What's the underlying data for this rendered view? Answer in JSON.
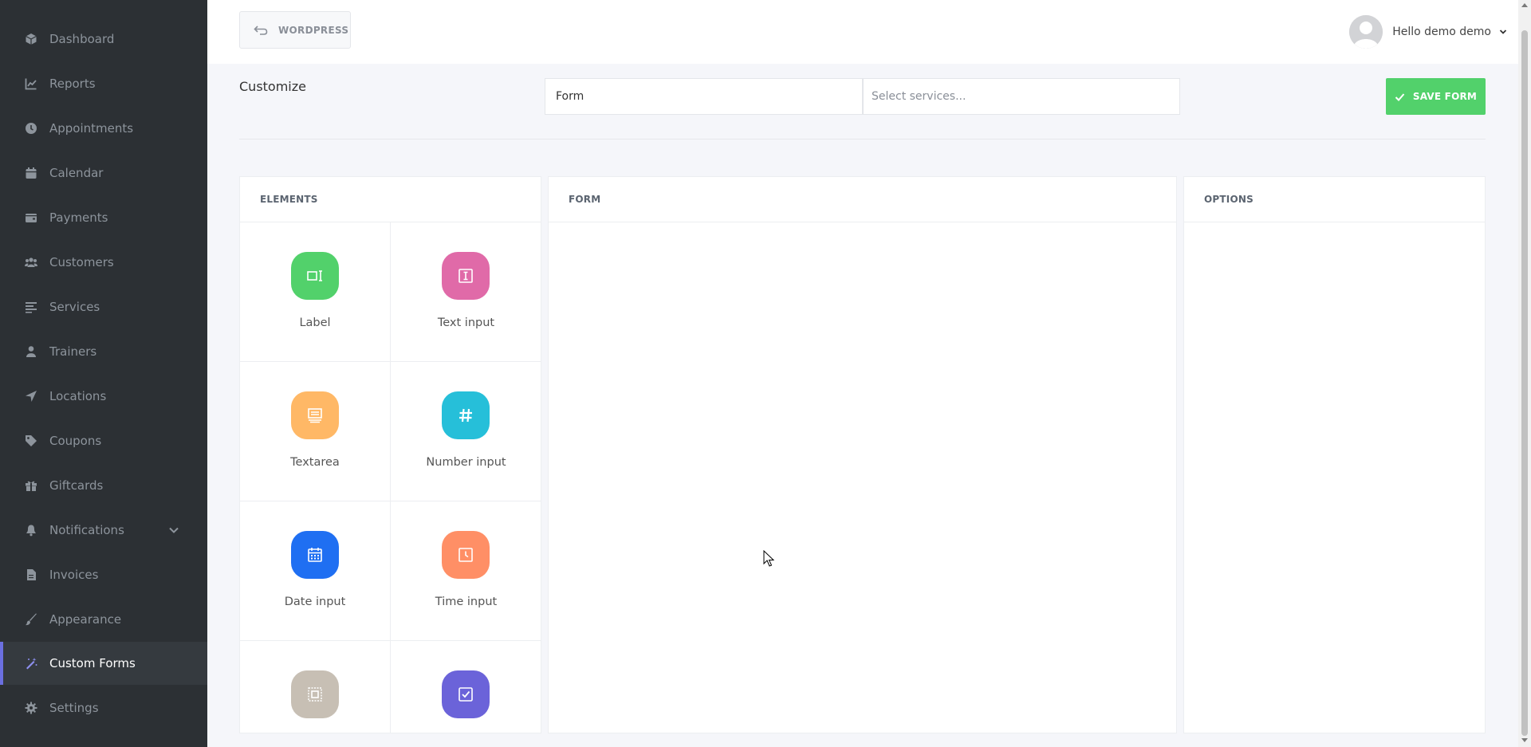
{
  "sidebar": {
    "items": [
      {
        "label": "Dashboard",
        "icon": "cube-icon"
      },
      {
        "label": "Reports",
        "icon": "chart-line-icon"
      },
      {
        "label": "Appointments",
        "icon": "clock-icon"
      },
      {
        "label": "Calendar",
        "icon": "calendar-icon"
      },
      {
        "label": "Payments",
        "icon": "wallet-icon"
      },
      {
        "label": "Customers",
        "icon": "users-icon"
      },
      {
        "label": "Services",
        "icon": "list-icon"
      },
      {
        "label": "Trainers",
        "icon": "user-icon"
      },
      {
        "label": "Locations",
        "icon": "location-arrow-icon"
      },
      {
        "label": "Coupons",
        "icon": "tag-icon"
      },
      {
        "label": "Giftcards",
        "icon": "gift-icon"
      },
      {
        "label": "Notifications",
        "icon": "bell-icon",
        "has_submenu": true
      },
      {
        "label": "Invoices",
        "icon": "file-icon"
      },
      {
        "label": "Appearance",
        "icon": "brush-icon"
      },
      {
        "label": "Custom Forms",
        "icon": "magic-wand-icon",
        "active": true
      },
      {
        "label": "Settings",
        "icon": "gear-icon"
      }
    ]
  },
  "topbar": {
    "back_label": "WORDPRESS",
    "user_greeting": "Hello demo demo"
  },
  "header": {
    "title": "Customize",
    "form_name_value": "Form",
    "services_placeholder": "Select services...",
    "save_label": "SAVE FORM"
  },
  "panels": {
    "elements_title": "ELEMENTS",
    "form_title": "FORM",
    "options_title": "OPTIONS"
  },
  "elements": [
    {
      "label": "Label",
      "color": "#52d16b",
      "icon": "label-icon"
    },
    {
      "label": "Text input",
      "color": "#e06aa8",
      "icon": "text-input-icon"
    },
    {
      "label": "Textarea",
      "color": "#ffb866",
      "icon": "textarea-icon"
    },
    {
      "label": "Number input",
      "color": "#26bfd9",
      "icon": "hash-icon"
    },
    {
      "label": "Date input",
      "color": "#1f6ff2",
      "icon": "calendar-icon"
    },
    {
      "label": "Time input",
      "color": "#ff8f66",
      "icon": "clock-icon"
    },
    {
      "label": "",
      "color": "#c7bfb4",
      "icon": "select-icon"
    },
    {
      "label": "",
      "color": "#6b63d9",
      "icon": "checkbox-icon"
    }
  ],
  "colors": {
    "sidebar_bg": "#2c3034",
    "accent": "#6b6fe0",
    "save_green": "#52d16b"
  }
}
